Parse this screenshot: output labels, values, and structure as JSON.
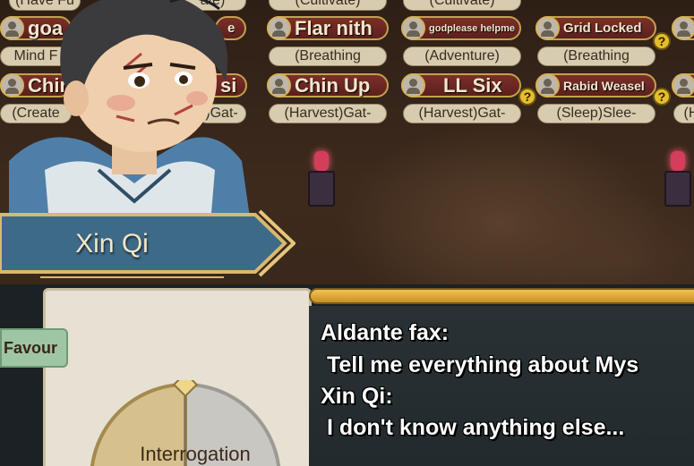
{
  "players": {
    "row1_names": [
      {
        "name": "goa",
        "size": "lg"
      },
      {
        "name": "Flar nith",
        "size": "lg"
      },
      {
        "name": "godplease helpme",
        "size": "xs"
      },
      {
        "name": "Grid Locked",
        "size": "sm"
      }
    ],
    "row1_tags": [
      "Mind F",
      "(Breathing",
      "(Adventure)",
      "(Breathing"
    ],
    "row2_names": [
      {
        "name": "Chin",
        "size": "lg"
      },
      {
        "name": "si",
        "size": "lg"
      },
      {
        "name": "Chin Up",
        "size": "lg"
      },
      {
        "name": "LL Six",
        "size": "lg"
      },
      {
        "name": "Rabid Weasel",
        "size": "xs"
      }
    ],
    "row2_tags": [
      "(Create",
      ")Gat-",
      "(Harvest)Gat-",
      "(Harvest)Gat-",
      "(Sleep)Slee-",
      "(H"
    ],
    "top_tags": [
      "(Have Fu",
      "ate)",
      "(Cultivate)",
      "(Cultivate)"
    ],
    "partial_name": "e",
    "help_mark": "?"
  },
  "dialogue": {
    "speaker_name": "Xin Qi",
    "lines": [
      "Aldante fax:",
      " Tell me everything about Mys",
      "Xin Qi:",
      " I don't know anything else..."
    ]
  },
  "sidebar": {
    "favour_label": "Favour"
  },
  "interaction_wheel": {
    "label": "Interrogation"
  },
  "colors": {
    "banner": "#3d6a87",
    "banner_border": "#d9b870",
    "gold_bar": "#e4b13e",
    "panel_bg": "#e7e1d3",
    "favour_tab": "#9fc6a4"
  }
}
